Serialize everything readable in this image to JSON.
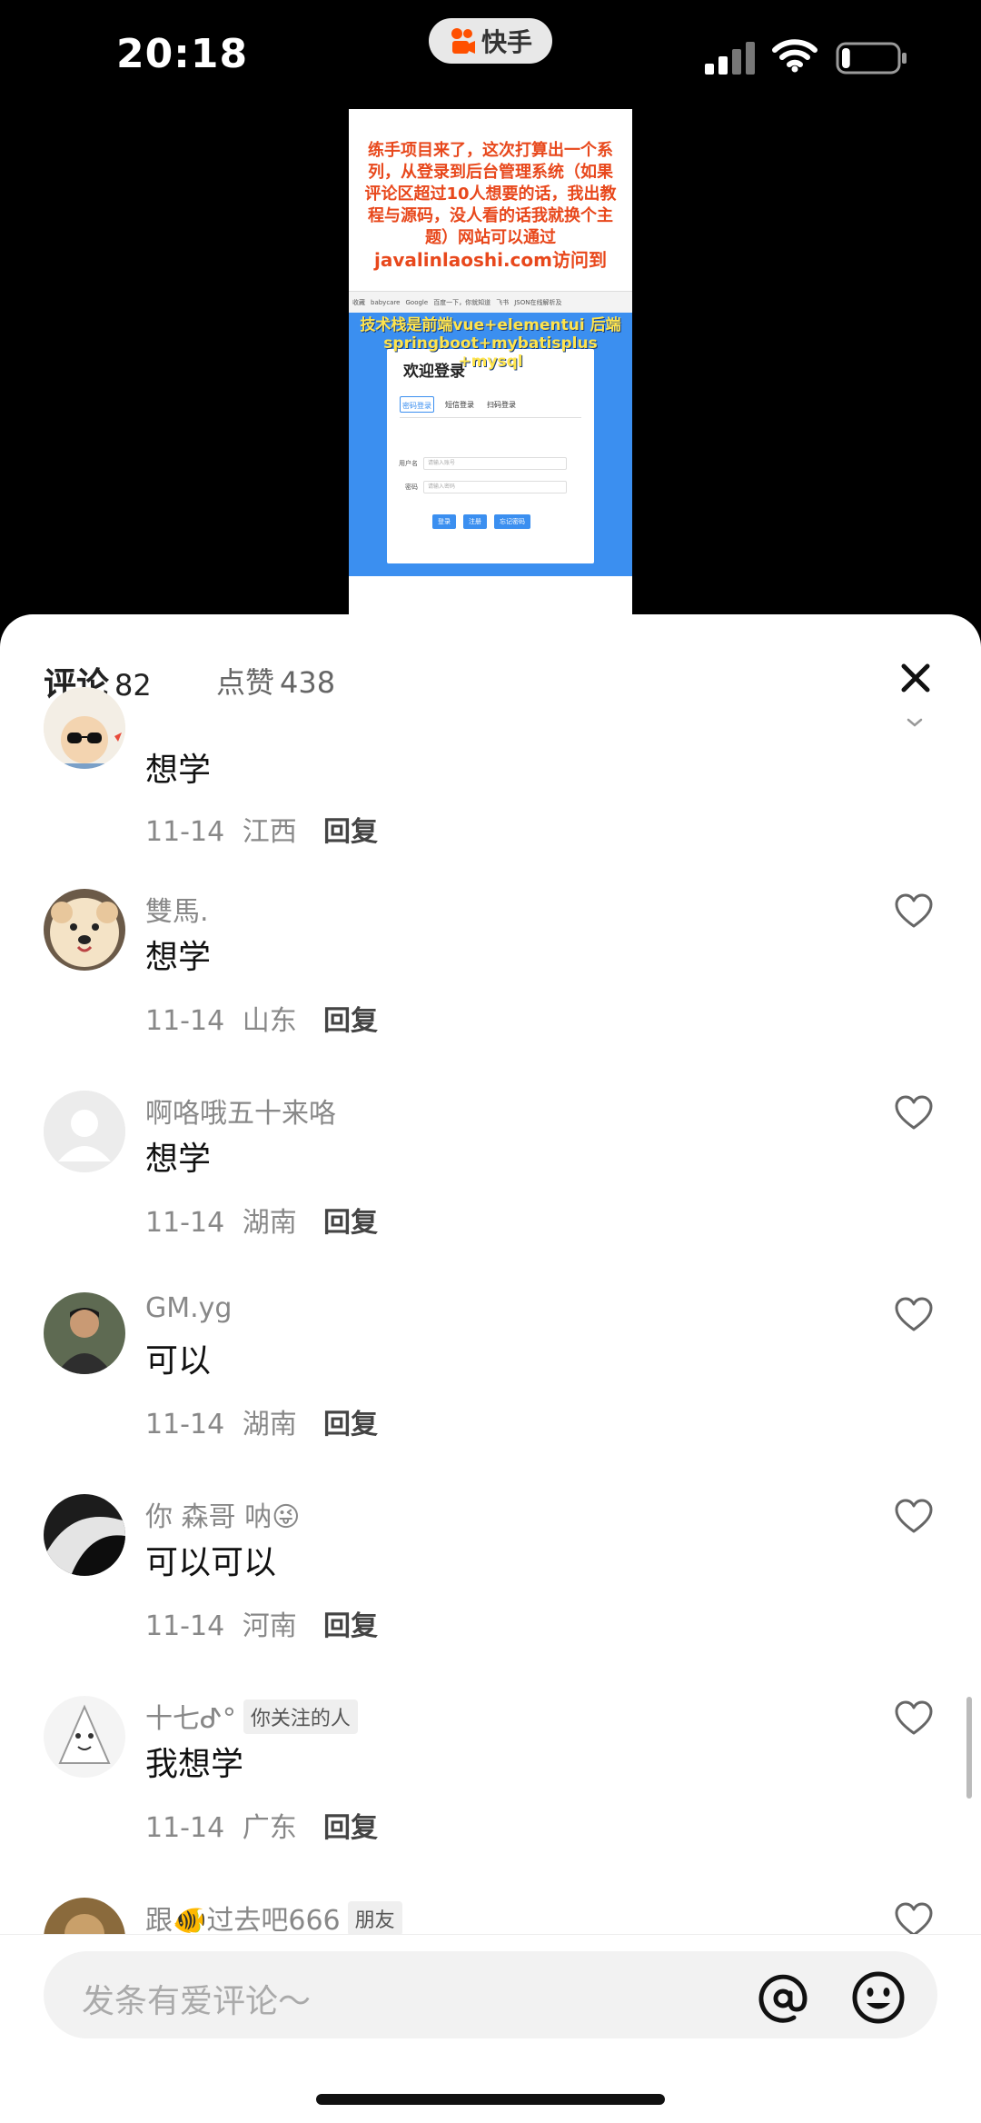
{
  "status_bar": {
    "time": "20:18",
    "app_name": "快手",
    "icons": [
      "cellular-signal-icon",
      "wifi-icon",
      "battery-icon"
    ],
    "battery_level": 0.15
  },
  "video": {
    "caption": "练手项目来了，这次打算出一个系列，从登录到后台管理系统（如果评论区超过10人想要的话，我出教程与源码，没人看的话我就换个主题）网站可以通过",
    "url": "javalinlaoshi.com访问到",
    "tech_caption": "技术栈是前端vue+elementui 后端springboot+mybatisplus +mysql",
    "browser_bookmarks": [
      "收藏",
      "babycare",
      "Google",
      "百度一下，你就知道",
      "飞书",
      "JSON在线解析及"
    ],
    "login": {
      "title": "欢迎登录",
      "tabs": [
        "密码登录",
        "短信登录",
        "扫码登录"
      ],
      "username_label": "用户名",
      "username_placeholder": "请输入账号",
      "password_label": "密码",
      "password_placeholder": "请输入密码",
      "buttons": [
        "登录",
        "注册",
        "忘记密码"
      ]
    }
  },
  "sheet": {
    "comments_label": "评论",
    "comments_count": "82",
    "likes_label": "点赞",
    "likes_count": "438",
    "reply_label": "回复",
    "comments": [
      {
        "name": "",
        "tag": "",
        "text": "想学",
        "date": "11-14",
        "region": "江西"
      },
      {
        "name": "雙馬.",
        "tag": "",
        "text": "想学",
        "date": "11-14",
        "region": "山东"
      },
      {
        "name": "啊咯哦五十来咯",
        "tag": "",
        "text": "想学",
        "date": "11-14",
        "region": "湖南"
      },
      {
        "name": "GM.yg",
        "tag": "",
        "text": "可以",
        "date": "11-14",
        "region": "湖南"
      },
      {
        "name": "你 森哥 呐😜",
        "tag": "",
        "text": "可以可以",
        "date": "11-14",
        "region": "河南"
      },
      {
        "name": "十七ᕷ°",
        "tag": "你关注的人",
        "text": "我想学",
        "date": "11-14",
        "region": "广东"
      },
      {
        "name": "跟🐠过去吧666",
        "tag": "朋友",
        "text": "",
        "date": "",
        "region": ""
      }
    ]
  },
  "input": {
    "placeholder": "发条有爱评论～",
    "icons": [
      "at-icon",
      "emoji-icon"
    ]
  },
  "colors": {
    "accent_orange": "#e8481c",
    "video_blue": "#3b8ff0",
    "sheet_bg": "#ffffff",
    "input_bg": "#f2f2f2"
  }
}
